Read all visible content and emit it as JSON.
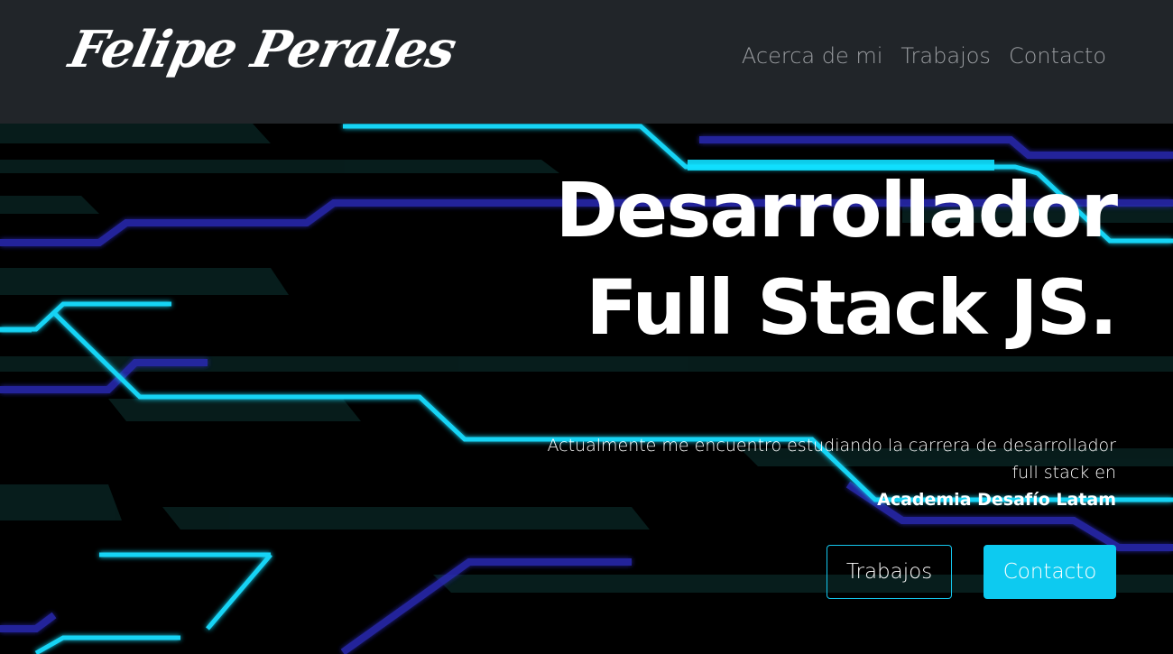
{
  "brand": {
    "name": "Felipe Perales"
  },
  "nav": {
    "items": [
      {
        "label": "Acerca de mi"
      },
      {
        "label": "Trabajos"
      },
      {
        "label": "Contacto"
      }
    ]
  },
  "hero": {
    "title_line1": "Desarrollador",
    "title_line2": "Full Stack JS.",
    "description": "Actualmente me encuentro estudiando la carrera de desarrollador full stack en",
    "academy": "Academia Desafío Latam",
    "buttons": {
      "works_label": "Trabajos",
      "contact_label": "Contacto"
    }
  },
  "colors": {
    "navbar_bg": "#212529",
    "nav_link": "#9a9da1",
    "accent_cyan": "#0dcaf0",
    "circuit_blue": "#2a2bb0",
    "background": "#000000"
  }
}
